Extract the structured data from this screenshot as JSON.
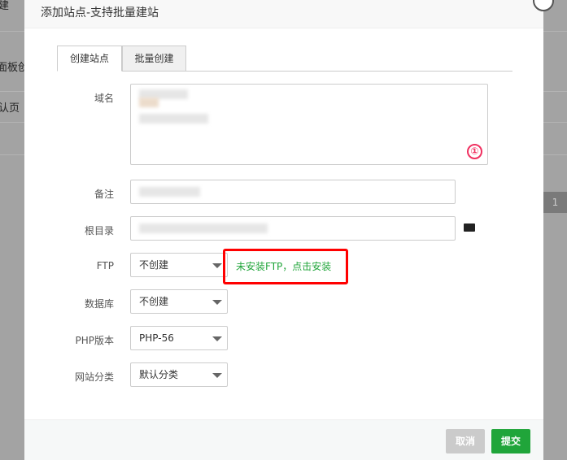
{
  "background": {
    "texts": [
      "建",
      "面板创建",
      "认页"
    ],
    "page_number": "1"
  },
  "modal": {
    "title": "添加站点-支持批量建站",
    "tabs": [
      {
        "label": "创建站点",
        "active": true
      },
      {
        "label": "批量创建",
        "active": false
      }
    ],
    "fields": {
      "domain": {
        "label": "域名",
        "annotation": "①"
      },
      "remark": {
        "label": "备注"
      },
      "root": {
        "label": "根目录"
      },
      "ftp": {
        "label": "FTP",
        "value": "不创建",
        "hint": "未安装FTP，点击安装"
      },
      "database": {
        "label": "数据库",
        "value": "不创建"
      },
      "php": {
        "label": "PHP版本",
        "value": "PHP-56"
      },
      "category": {
        "label": "网站分类",
        "value": "默认分类"
      }
    },
    "buttons": {
      "cancel": "取消",
      "submit": "提交"
    },
    "colors": {
      "accent": "#20a53a",
      "highlight": "#ff0000",
      "annotation": "#f03060"
    }
  }
}
